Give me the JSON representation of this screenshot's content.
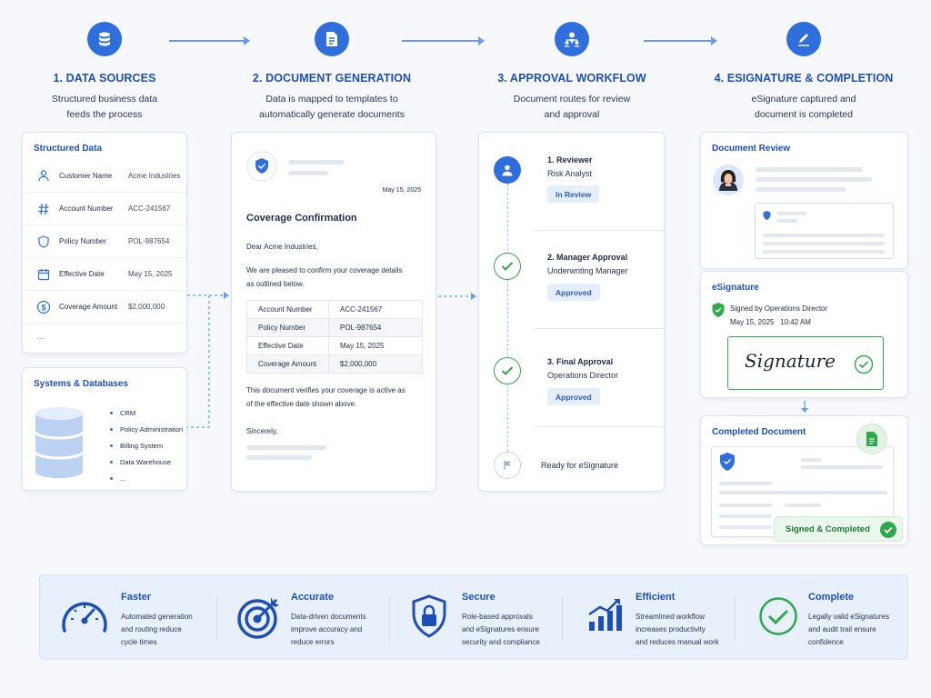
{
  "steps": [
    {
      "title": "1. DATA SOURCES",
      "desc1": "Structured business data",
      "desc2": "feeds the process",
      "icon": "database-icon"
    },
    {
      "title": "2. DOCUMENT GENERATION",
      "desc1": "Data is mapped to templates to",
      "desc2": "automatically generate documents",
      "icon": "document-icon"
    },
    {
      "title": "3. APPROVAL WORKFLOW",
      "desc1": "Document routes for review",
      "desc2": "and approval",
      "icon": "team-icon"
    },
    {
      "title": "4. ESIGNATURE & COMPLETION",
      "desc1": "eSignature captured and",
      "desc2": "document is completed",
      "icon": "pen-icon"
    }
  ],
  "structured": {
    "title": "Structured Data",
    "rows": [
      {
        "label": "Customer Name",
        "value": "Acme Industries",
        "icon": "user-icon"
      },
      {
        "label": "Account Number",
        "value": "ACC-241567",
        "icon": "hash-icon"
      },
      {
        "label": "Policy Number",
        "value": "POL-987654",
        "icon": "shield-icon"
      },
      {
        "label": "Effective Date",
        "value": "May 15, 2025",
        "icon": "calendar-icon"
      },
      {
        "label": "Coverage Amount",
        "value": "$2,000,000",
        "icon": "dollar-icon"
      }
    ],
    "more": "..."
  },
  "systems": {
    "title": "Systems & Databases",
    "items": [
      "CRM",
      "Policy Administration",
      "Billing System",
      "Data Warehouse",
      "..."
    ]
  },
  "document": {
    "date": "May 15, 2025",
    "heading": "Coverage Confirmation",
    "greeting": "Dear Acme Industries,",
    "intro1": "We are pleased to confirm your coverage details",
    "intro2": "as outlined below.",
    "table": [
      [
        "Account Number",
        "ACC-241567"
      ],
      [
        "Policy Number",
        "POL-987654"
      ],
      [
        "Effective Date",
        "May 15, 2025"
      ],
      [
        "Coverage Amount",
        "$2,000,000"
      ]
    ],
    "verify1": "This document verifies your coverage is active as",
    "verify2": "of the effective date shown above.",
    "closing": "Sincerely,"
  },
  "workflow": {
    "steps": [
      {
        "name": "1. Reviewer",
        "role": "Risk Analyst",
        "status": "In Review"
      },
      {
        "name": "2. Manager Approval",
        "role": "Underwriting Manager",
        "status": "Approved"
      },
      {
        "name": "3. Final Approval",
        "role": "Operations Director",
        "status": "Approved"
      }
    ],
    "final": "Ready for eSignature"
  },
  "review": {
    "title": "Document Review"
  },
  "esign": {
    "title": "eSignature",
    "signed_by": "Signed by Operations Director",
    "signed_at": "May 15, 2025   10:42 AM",
    "signature": "Signature"
  },
  "completed": {
    "title": "Completed Document",
    "badge": "Signed & Completed"
  },
  "benefits": [
    {
      "title": "Faster",
      "l1": "Automated generation",
      "l2": "and routing reduce",
      "l3": "cycle times",
      "icon": "speedometer-icon"
    },
    {
      "title": "Accurate",
      "l1": "Data-driven documents",
      "l2": "improve accuracy and",
      "l3": "reduce errors",
      "icon": "target-icon"
    },
    {
      "title": "Secure",
      "l1": "Role-based approvals",
      "l2": "and eSignatures ensure",
      "l3": "security and compliance",
      "icon": "lock-shield-icon"
    },
    {
      "title": "Efficient",
      "l1": "Streamlined workflow",
      "l2": "increases productivity",
      "l3": "and reduces manual work",
      "icon": "growth-chart-icon"
    },
    {
      "title": "Complete",
      "l1": "Legally valid eSignatures",
      "l2": "and audit trail ensure",
      "l3": "confidence",
      "icon": "check-circle-icon"
    }
  ],
  "colors": {
    "primary": "#2f6fdd",
    "heading": "#1e4fb4",
    "success": "#2ea84a",
    "badge_bg": "#e6eefc"
  }
}
